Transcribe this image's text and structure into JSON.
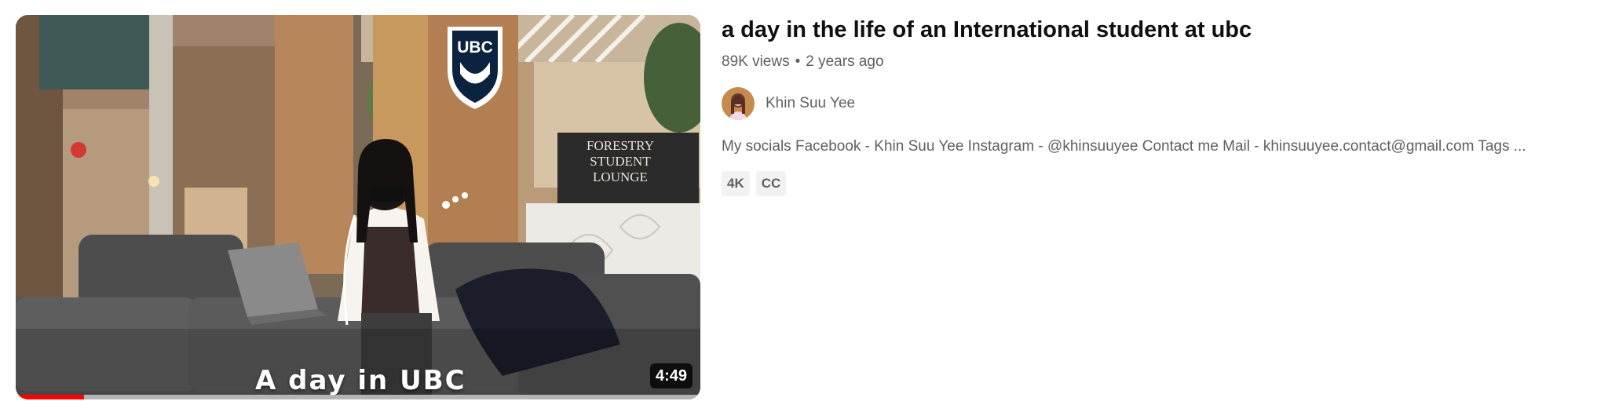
{
  "video": {
    "title": "a day in the life of an International student at ubc",
    "views": "89K views",
    "separator": "•",
    "age": "2 years ago",
    "duration": "4:49",
    "thumbnail_caption": "A day in UBC",
    "thumbnail_signage": {
      "logo_text": "UBC",
      "sign_lines": [
        "FORESTRY",
        "STUDENT",
        "LOUNGE"
      ]
    },
    "watch_progress_fraction": 0.1,
    "channel": {
      "name": "Khin Suu Yee"
    },
    "description_snippet": "My socials Facebook - Khin Suu Yee Instagram - @khinsuuyee Contact me Mail - khinsuuyee.contact@gmail.com Tags ...",
    "badges": [
      "4K",
      "CC"
    ]
  },
  "colors": {
    "progress": "#ff0000",
    "title": "#0f0f0f",
    "meta": "#606060",
    "badge_bg": "#f2f2f2"
  }
}
